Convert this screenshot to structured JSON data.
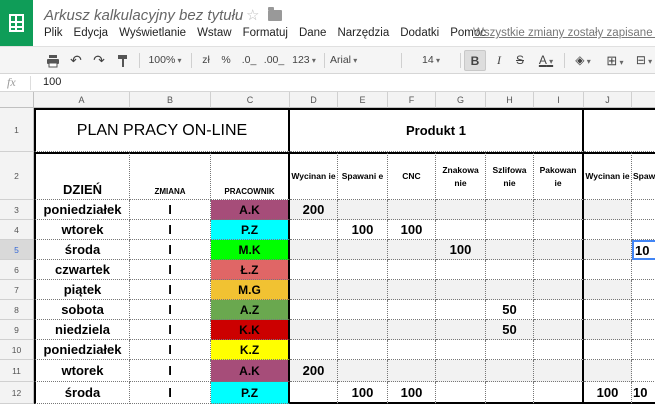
{
  "app": {
    "doc_title": "Arkusz kalkulacyjny bez tytułu",
    "menu": [
      "Plik",
      "Edycja",
      "Wyświetlanie",
      "Wstaw",
      "Formatuj",
      "Dane",
      "Narzędzia",
      "Dodatki",
      "Pomoc"
    ],
    "save_status": "Wszystkie zmiany zostały zapisane na D",
    "accent_color": "#0f9d58"
  },
  "toolbar": {
    "zoom": "100%",
    "currency": "zł",
    "percent": "%",
    "dec_decrease": ".0_",
    "dec_increase": ".00_",
    "more_formats": "123",
    "font": "Arial",
    "font_size": "14",
    "bold": "B",
    "italic": "I",
    "strike": "S",
    "text_color": "A"
  },
  "formula_bar": {
    "fx": "fx",
    "value": "100"
  },
  "columns": [
    "A",
    "B",
    "C",
    "D",
    "E",
    "F",
    "G",
    "H",
    "I",
    "J",
    "K"
  ],
  "rows": [
    "1",
    "2",
    "3",
    "4",
    "5",
    "6",
    "7",
    "8",
    "9",
    "10",
    "11",
    "12"
  ],
  "sheet": {
    "title": "PLAN PRACY ON-LINE",
    "product": "Produkt 1",
    "headers": {
      "day": "DZIEŃ",
      "shift": "ZMIANA",
      "worker": "PRACOWNIK",
      "ops": [
        "Wycinan ie",
        "Spawani e",
        "CNC",
        "Znakowa nie",
        "Szlifowa nie",
        "Pakowan ie",
        "Wycinan ie",
        "Spaw"
      ]
    },
    "data": [
      {
        "day": "poniedziałek",
        "shift": "I",
        "worker": "A.K",
        "color": "#a64d79",
        "D": "200",
        "E": "",
        "F": "",
        "G": "",
        "H": "",
        "I": "",
        "J": "",
        "K": ""
      },
      {
        "day": "wtorek",
        "shift": "I",
        "worker": "P.Z",
        "color": "#00ffff",
        "D": "",
        "E": "100",
        "F": "100",
        "G": "",
        "H": "",
        "I": "",
        "J": "",
        "K": ""
      },
      {
        "day": "środa",
        "shift": "I",
        "worker": "M.K",
        "color": "#00ff00",
        "D": "",
        "E": "",
        "F": "",
        "G": "100",
        "H": "",
        "I": "",
        "J": "",
        "K": "10"
      },
      {
        "day": "czwartek",
        "shift": "I",
        "worker": "Ł.Z",
        "color": "#e06666",
        "D": "",
        "E": "",
        "F": "",
        "G": "",
        "H": "",
        "I": "",
        "J": "",
        "K": ""
      },
      {
        "day": "piątek",
        "shift": "I",
        "worker": "M.G",
        "color": "#f1c232",
        "D": "",
        "E": "",
        "F": "",
        "G": "",
        "H": "",
        "I": "",
        "J": "",
        "K": ""
      },
      {
        "day": "sobota",
        "shift": "I",
        "worker": "A.Z",
        "color": "#6aa84f",
        "D": "",
        "E": "",
        "F": "",
        "G": "",
        "H": "50",
        "I": "",
        "J": "",
        "K": ""
      },
      {
        "day": "niedziela",
        "shift": "I",
        "worker": "K.K",
        "color": "#cc0000",
        "D": "",
        "E": "",
        "F": "",
        "G": "",
        "H": "50",
        "I": "",
        "J": "",
        "K": ""
      },
      {
        "day": "poniedziałek",
        "shift": "I",
        "worker": "K.Z",
        "color": "#ffff00",
        "D": "",
        "E": "",
        "F": "",
        "G": "",
        "H": "",
        "I": "",
        "J": "",
        "K": ""
      },
      {
        "day": "wtorek",
        "shift": "I",
        "worker": "A.K",
        "color": "#a64d79",
        "D": "200",
        "E": "",
        "F": "",
        "G": "",
        "H": "",
        "I": "",
        "J": "",
        "K": ""
      },
      {
        "day": "środa",
        "shift": "I",
        "worker": "P.Z",
        "color": "#00ffff",
        "D": "",
        "E": "100",
        "F": "100",
        "G": "",
        "H": "",
        "I": "",
        "J": "100",
        "K": "10"
      }
    ]
  }
}
